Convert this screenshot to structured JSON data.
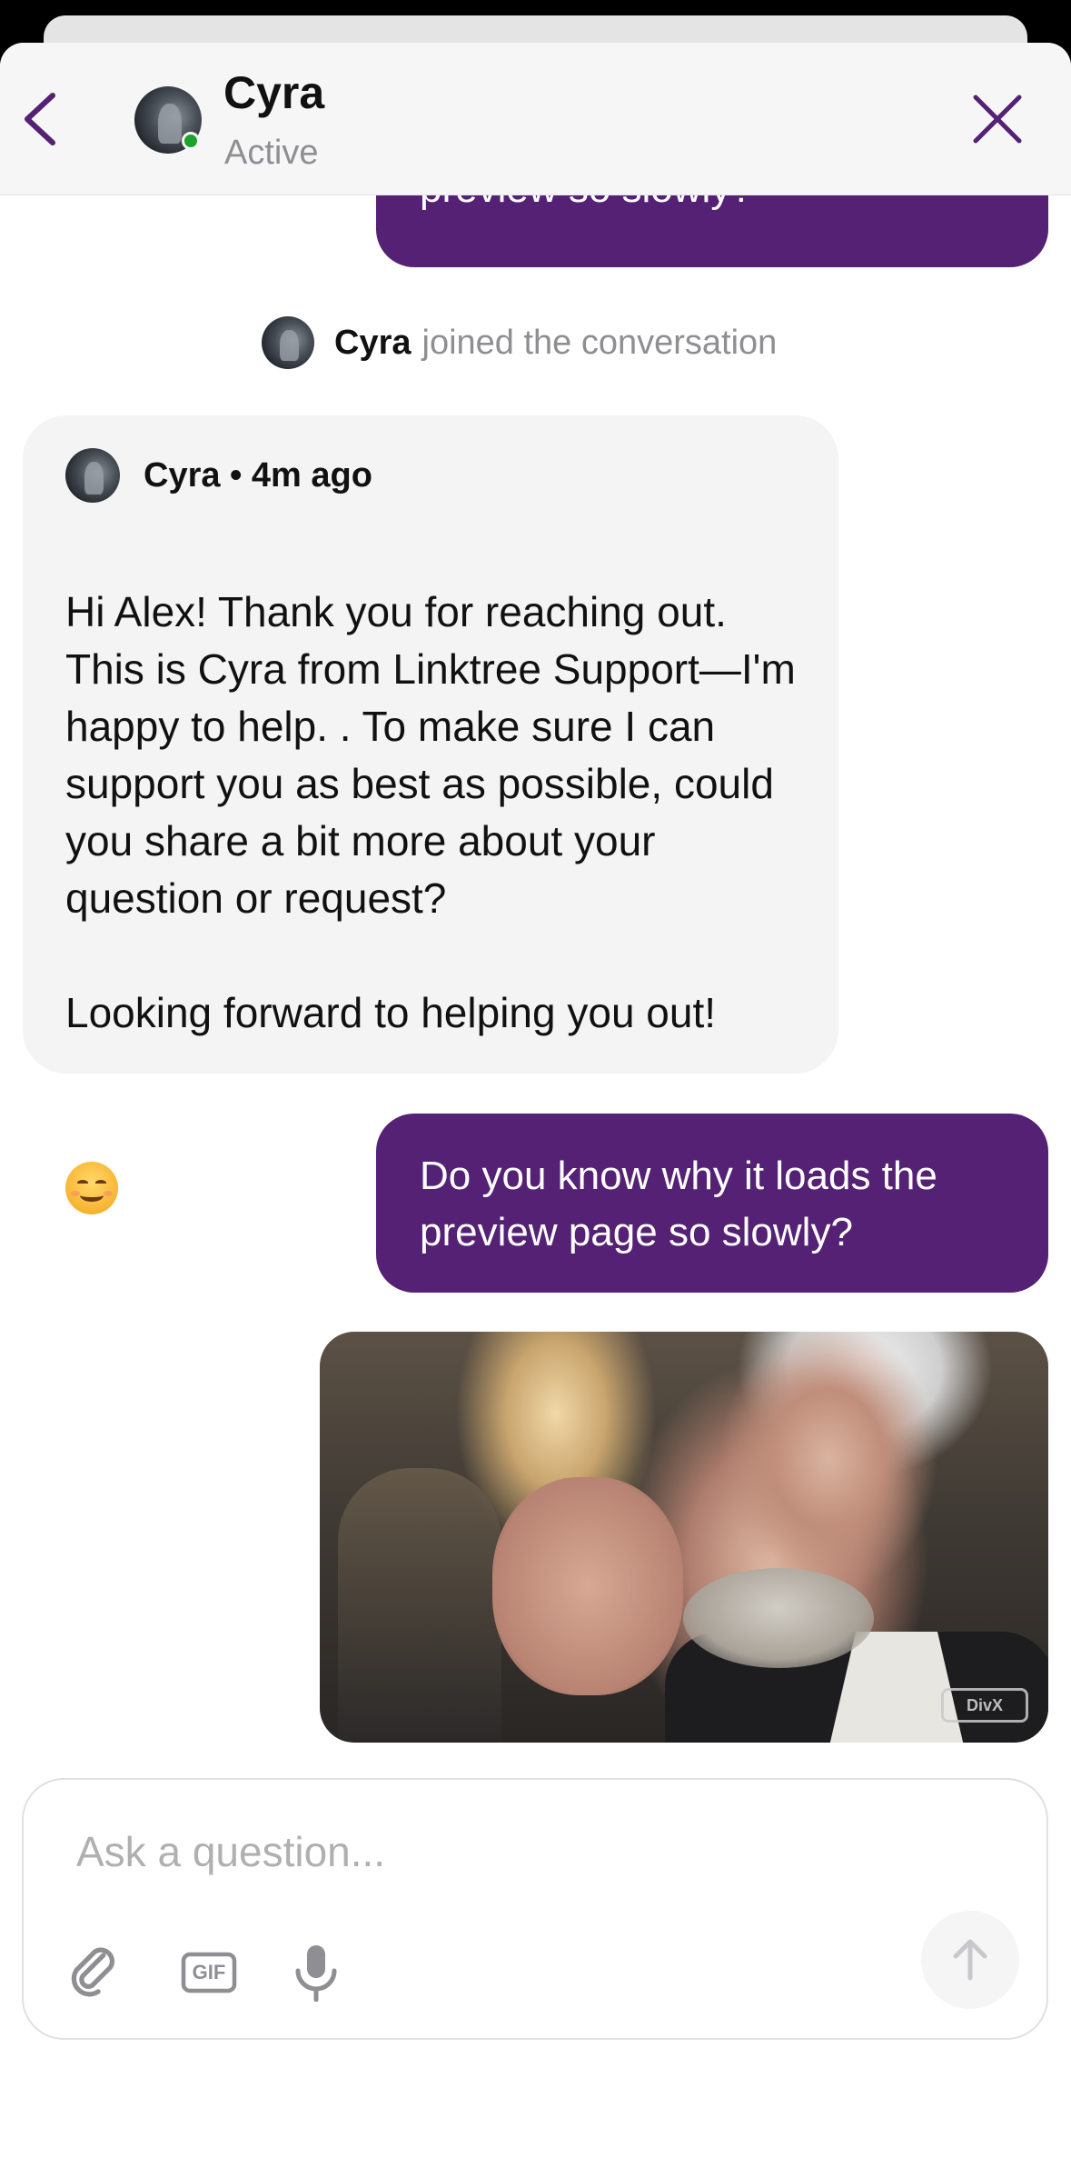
{
  "header": {
    "contact_name": "Cyra",
    "status": "Active"
  },
  "messages": {
    "previous_outgoing": "preview so slowly?",
    "system_event": {
      "name": "Cyra",
      "text": "joined the conversation"
    },
    "agent_message": {
      "meta": "Cyra • 4m ago",
      "body": "Hi Alex! Thank you for reaching out. This is Cyra from Linktree Support—I'm happy to help. . To make sure I can support you as best as possible, could you share a bit more about your question or request?\n\nLooking forward to helping you out!"
    },
    "user_question": "Do you know why it loads the preview page so slowly?",
    "gif_watermark": "DivX"
  },
  "composer": {
    "placeholder": "Ask a question...",
    "tools": [
      "paperclip-icon",
      "gif-icon",
      "microphone-icon"
    ],
    "gif_label": "GIF",
    "send_icon": "arrow-up-icon"
  },
  "colors": {
    "outgoing_bubble": "#552174",
    "incoming_bubble": "#f4f4f4",
    "accent": "#552174",
    "online": "#1fa12e"
  }
}
